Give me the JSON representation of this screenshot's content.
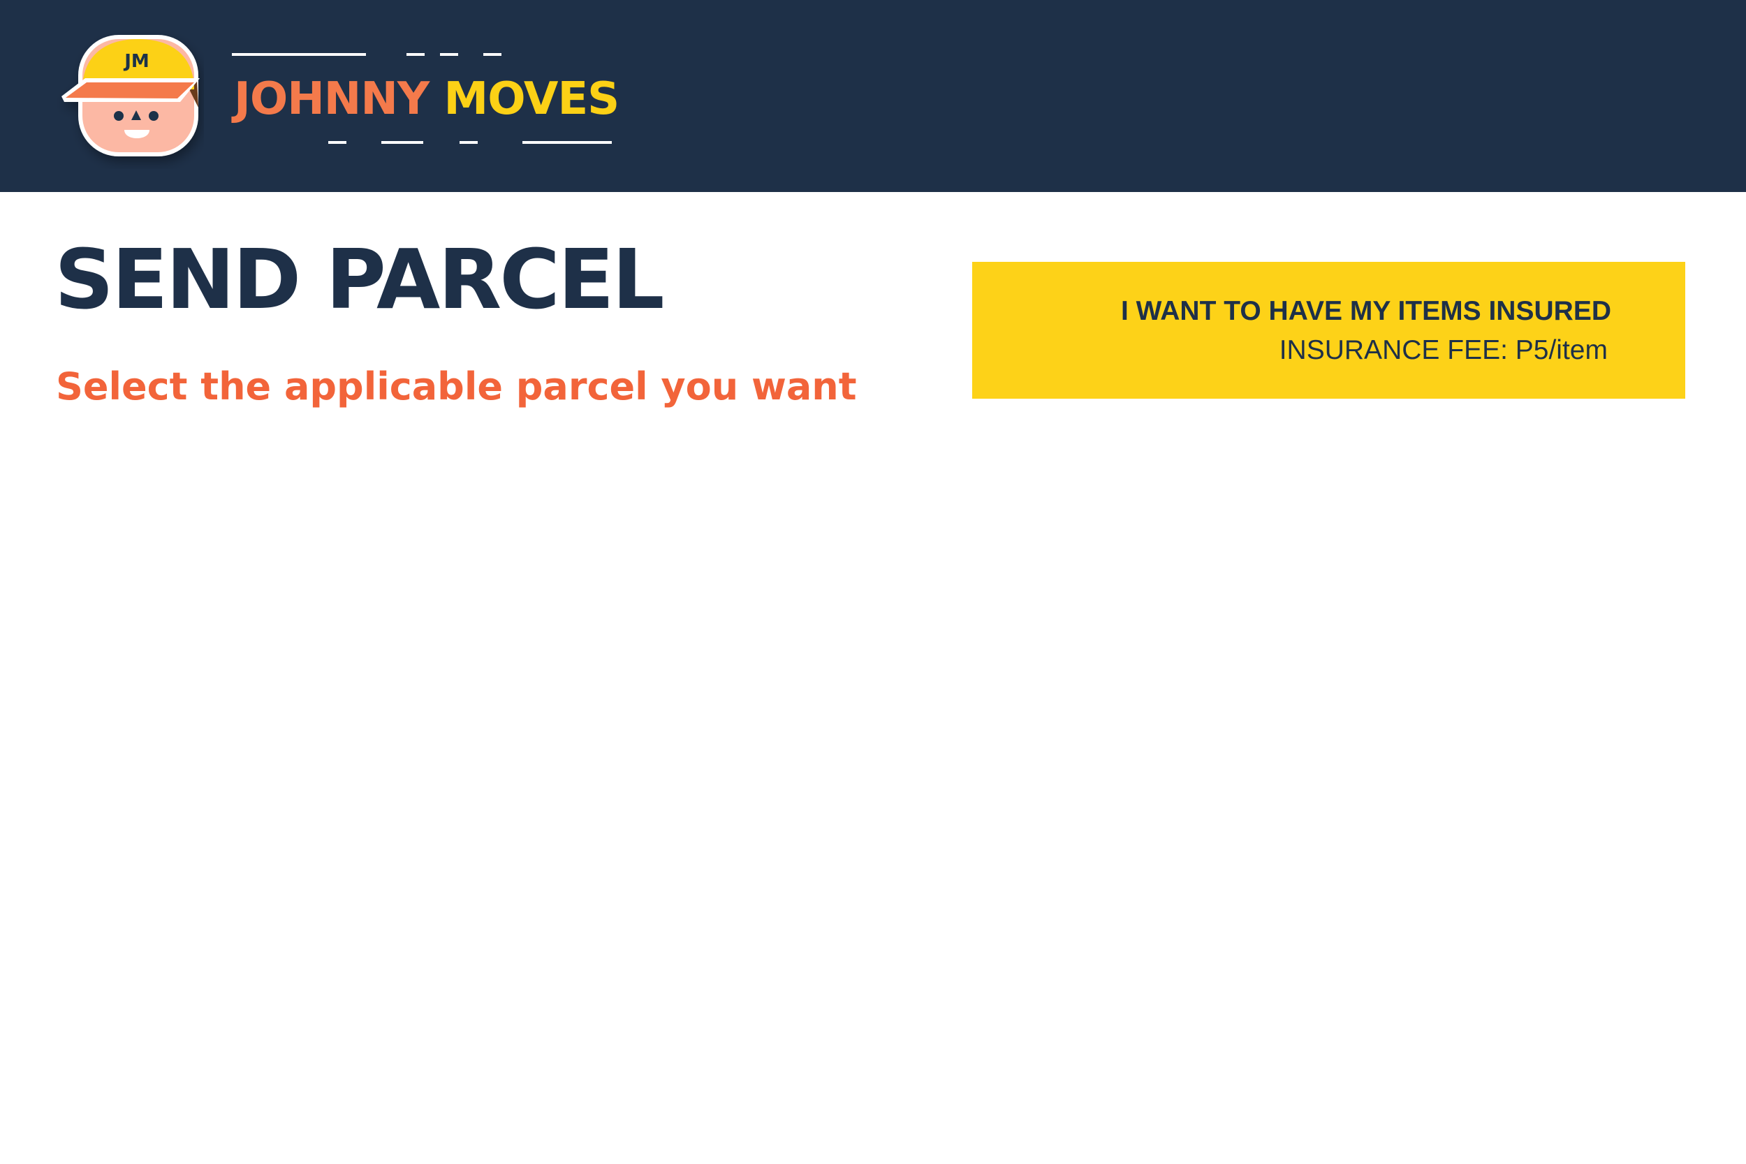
{
  "brand": {
    "logo_initials": "JM",
    "name_first": "JOHNNY",
    "name_last": "MOVES"
  },
  "page": {
    "title": "SEND PARCEL",
    "subtitle": "Select the applicable parcel you want"
  },
  "insurance": {
    "heading": "I WANT TO HAVE MY ITEMS INSURED",
    "fee": "INSURANCE FEE: P5/item"
  },
  "colors": {
    "header_bg": "#1e3048",
    "brand_first": "#f47a4b",
    "brand_last": "#fcd116",
    "accent_orange": "#f2643a",
    "insurance_bg": "#fdd218",
    "text_dark": "#1e3048"
  },
  "icons": {
    "logo": "mascot-face-with-cap-icon"
  }
}
